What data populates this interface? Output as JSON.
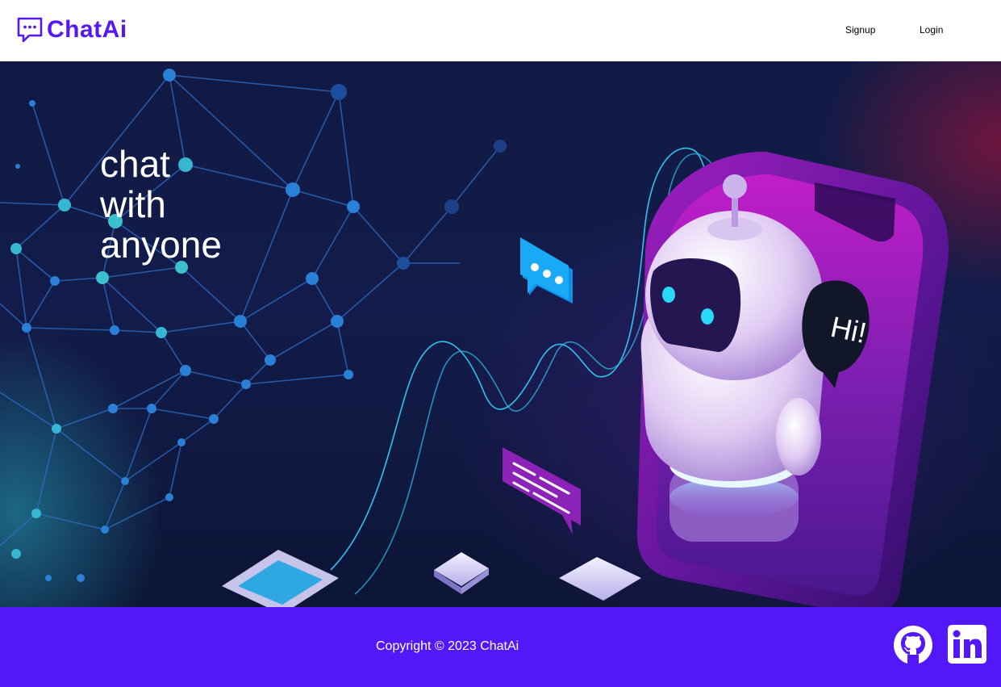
{
  "header": {
    "brand": "ChatAi",
    "brand_color": "#5518f0",
    "icons": {
      "logo": "chat-bubble-dots-icon"
    },
    "nav": {
      "signup": "Signup",
      "login": "Login"
    }
  },
  "hero": {
    "tagline": [
      "chat",
      "with",
      "anyone"
    ],
    "robot_bubble_text": "Hi!"
  },
  "footer": {
    "copyright": "Copyright © 2023 ChatAi",
    "background": "#5218fa",
    "icons": {
      "github": "github-icon",
      "linkedin": "linkedin-icon"
    }
  }
}
